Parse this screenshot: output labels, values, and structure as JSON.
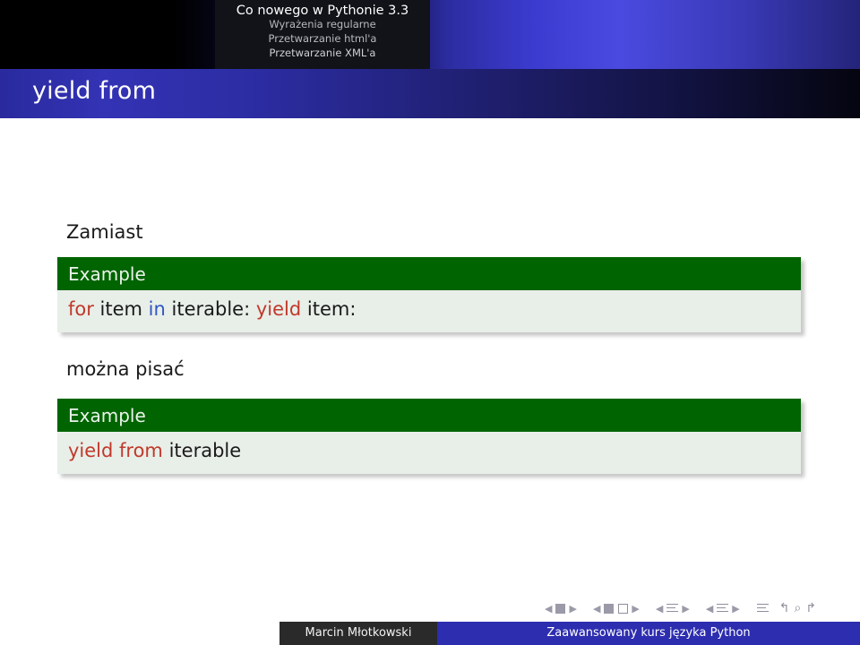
{
  "header": {
    "line1": "Co nowego w Pythonie 3.3",
    "line2": "Wyrażenia regularne",
    "line3": "Przetwarzanie html'a",
    "line4": "Przetwarzanie XML'a"
  },
  "slide": {
    "title": "yield from",
    "intro_text": "Zamiast",
    "middle_text": "można pisać",
    "examples": [
      {
        "title": "Example",
        "code_tokens": [
          {
            "text": "for",
            "style": "kw-red"
          },
          {
            "text": " item ",
            "style": "code-plain"
          },
          {
            "text": "in",
            "style": "kw-blue"
          },
          {
            "text": " iterable: ",
            "style": "code-plain"
          },
          {
            "text": "yield",
            "style": "kw-red"
          },
          {
            "text": " item:",
            "style": "code-plain"
          }
        ]
      },
      {
        "title": "Example",
        "code_tokens": [
          {
            "text": "yield from",
            "style": "kw-red"
          },
          {
            "text": " iterable",
            "style": "code-plain"
          }
        ]
      }
    ]
  },
  "footer": {
    "author": "Marcin Młotkowski",
    "course": "Zaawansowany kurs języka Python"
  },
  "nav": {
    "first_prev": "◀",
    "first_next": "▶",
    "back_icon": "↰",
    "search_icon": "⌕",
    "forward_icon": "↱"
  },
  "colors": {
    "title_bar": "#2a2a9e",
    "example_header": "#006400",
    "example_body": "#e8eee8",
    "footer_right": "#2d2db0",
    "footer_left": "#2a2a2a",
    "keyword_red": "#c0392b",
    "keyword_blue": "#2f56c7"
  }
}
